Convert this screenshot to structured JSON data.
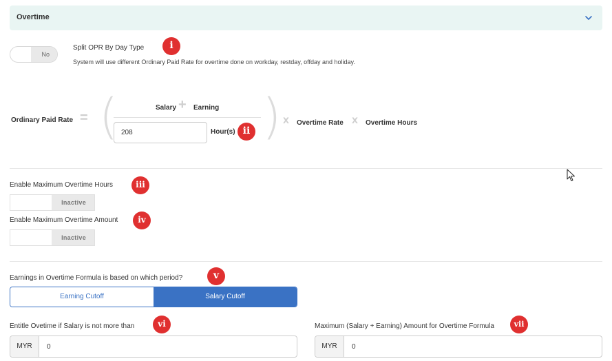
{
  "section": {
    "title": "Overtime",
    "chevron_icon": "chevron-down-icon"
  },
  "split_opr": {
    "toggle_label": "No",
    "title": "Split OPR By Day Type",
    "description": "System will use different Ordinary Paid Rate for overtime done on workday, restday, offday and holiday."
  },
  "formula": {
    "label": "Ordinary Paid Rate",
    "equals": "=",
    "salary": "Salary",
    "plus": "+",
    "earning": "Earning",
    "hours_value": "208",
    "hours_unit": "Hour(s)",
    "times1": "x",
    "overtime_rate": "Overtime Rate",
    "times2": "x",
    "overtime_hours": "Overtime Hours"
  },
  "max_hours": {
    "label": "Enable Maximum Overtime Hours",
    "status": "Inactive"
  },
  "max_amount": {
    "label": "Enable Maximum Overtime Amount",
    "status": "Inactive"
  },
  "period": {
    "question": "Earnings in Overtime Formula is based on which period?",
    "options": [
      "Earning Cutoff",
      "Salary Cutoff"
    ],
    "selected": "Salary Cutoff"
  },
  "entitle": {
    "label": "Entitle Ovetime if Salary is not more than",
    "currency": "MYR",
    "value": "0"
  },
  "maximum": {
    "label": "Maximum (Salary + Earning) Amount for Overtime Formula",
    "currency": "MYR",
    "value": "0"
  },
  "badges": [
    "i",
    "ii",
    "iii",
    "iv",
    "v",
    "vi",
    "vii"
  ],
  "colors": {
    "badge": "#e03030",
    "accent": "#3a72c4",
    "header_bg": "#e9f5f3"
  }
}
